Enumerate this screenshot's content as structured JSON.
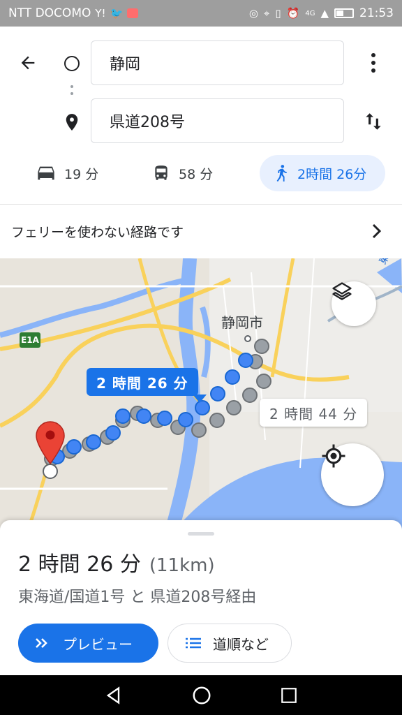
{
  "status_bar": {
    "carrier": "NTT DOCOMO",
    "time": "21:53",
    "network": "4G"
  },
  "header": {
    "origin": "静岡",
    "destination": "県道208号"
  },
  "modes": [
    {
      "icon": "car-icon",
      "label": "19 分"
    },
    {
      "icon": "bus-icon",
      "label": "58 分"
    },
    {
      "icon": "walk-icon",
      "label": "2時間 26分",
      "selected": true
    }
  ],
  "ferry_notice": "フェリーを使わない経路です",
  "map": {
    "city_label": "静岡市",
    "route_label": "2 時間 26 分",
    "alt_route_label": "2 時間 44 分",
    "road_shield": "E1A",
    "corner_label": "東海",
    "colors": {
      "route": "#1a73e8",
      "alt_route": "#9aa0a6",
      "water": "#8ab4f8",
      "road": "#f9d15b",
      "land": "#eceae5",
      "pin": "#ea4335"
    }
  },
  "sheet": {
    "duration": "2 時間 26 分",
    "distance": "(11km)",
    "via": "東海道/国道1号 と 県道208号経由",
    "preview_label": "プレビュー",
    "steps_label": "道順など"
  }
}
